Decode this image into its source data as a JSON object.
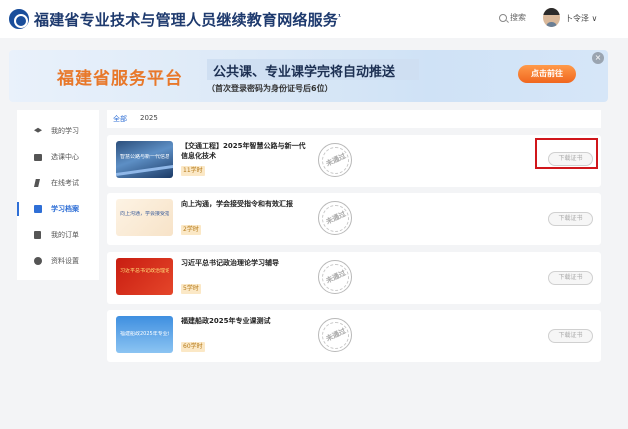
{
  "header": {
    "site_title": "福建省专业技术与管理人员继续教育网络服务",
    "title_suffix": "¹",
    "search_label": "搜索",
    "username": "卜令泽 ∨",
    "icons": {
      "logo": "logo-icon",
      "search": "search-icon",
      "avatar": "avatar"
    }
  },
  "banner": {
    "platform_name": "福建省服务平台",
    "headline": "公共课、专业课学完将自动推送",
    "subline": "（首次登录密码为身份证号后6位）",
    "cta": "点击前往",
    "close": "×"
  },
  "sidebar": {
    "items": [
      {
        "label": "我的学习",
        "icon": "graduation-cap-icon",
        "active": false
      },
      {
        "label": "选课中心",
        "icon": "monitor-icon",
        "active": false
      },
      {
        "label": "在线考试",
        "icon": "pen-icon",
        "active": false
      },
      {
        "label": "学习档案",
        "icon": "archive-icon",
        "active": true
      },
      {
        "label": "我的订单",
        "icon": "order-icon",
        "active": false
      },
      {
        "label": "资料设置",
        "icon": "gear-icon",
        "active": false
      }
    ]
  },
  "filter": {
    "all_label": "全部",
    "year_label": "2025"
  },
  "courses": [
    {
      "thumb_text": "智慧公路与新一代信息化技术",
      "title": "【交通工程】2025年智慧公路与新一代信息化技术",
      "hours": "11学时",
      "stamp": "未通过",
      "cert_button": "下载证书",
      "highlighted": true
    },
    {
      "thumb_text": "向上沟通，学会接受指令和有效汇报",
      "title": "向上沟通，学会接受指令和有效汇报",
      "hours": "2学时",
      "stamp": "未通过",
      "cert_button": "下载证书",
      "highlighted": false
    },
    {
      "thumb_text": "习近平总书记政治理论学习辅导",
      "title": "习近平总书记政治理论学习辅导",
      "hours": "5学时",
      "stamp": "未通过",
      "cert_button": "下载证书",
      "highlighted": false
    },
    {
      "thumb_text": "福建船政2025年专业课测试",
      "title": "福建船政2025年专业课测试",
      "hours": "60学时",
      "stamp": "未通过",
      "cert_button": "下载证书",
      "highlighted": false
    }
  ],
  "colors": {
    "accent": "#2f6fd6",
    "title": "#1e3a6e",
    "cta": "#f0661e",
    "highlight": "#d0161b",
    "badge_bg": "#fbe8c6"
  }
}
